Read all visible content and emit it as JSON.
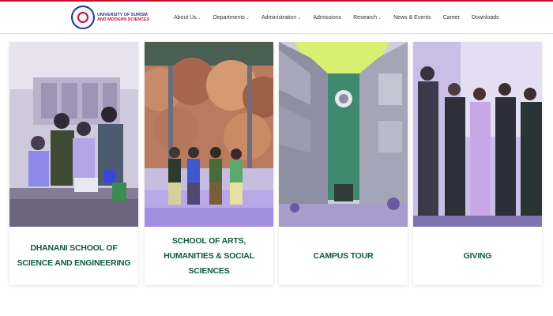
{
  "header": {
    "logo_line1": "UNIVERSITY OF SURISM",
    "logo_line2": "AND MODERN SCIENCES"
  },
  "nav": {
    "about": "About Us",
    "departments": "Departments",
    "administration": "Administration",
    "admissions": "Admissions",
    "research": "Research",
    "news": "News & Events",
    "career": "Career",
    "downloads": "Downloads"
  },
  "cards": [
    {
      "label": "DHANANI SCHOOL OF SCIENCE AND ENGINEERING"
    },
    {
      "label": "SCHOOL OF ARTS, HUMANITIES & SOCIAL SCIENCES"
    },
    {
      "label": "CAMPUS TOUR"
    },
    {
      "label": "GIVING"
    }
  ],
  "colors": {
    "accent": "#c8102e",
    "brand": "#1f3a8a",
    "label_green": "#0f5b3f"
  }
}
